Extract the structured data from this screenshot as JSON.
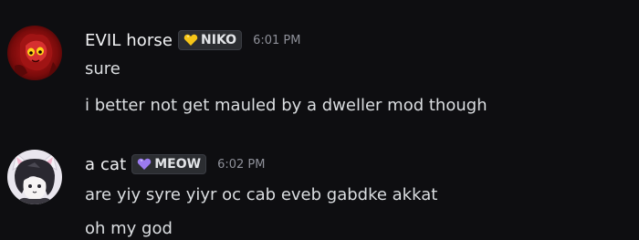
{
  "messages": [
    {
      "username": "EVIL horse",
      "tag": "NIKO",
      "tag_icon": "yellow-heart-icon",
      "tag_icon_color": "#f5c518",
      "timestamp": "6:01 PM",
      "lines": [
        "sure",
        "i better not get mauled by a dweller mod though"
      ]
    },
    {
      "username": "a cat",
      "tag": "MEOW",
      "tag_icon": "purple-heart-icon",
      "tag_icon_color": "#9b7bf0",
      "timestamp": "6:02 PM",
      "lines": [
        "are yiy syre yiyr oc cab eveb gabdke akkat",
        "oh my god"
      ]
    }
  ],
  "colors": {
    "background": "#0e0e11",
    "username": "#f2f3f5",
    "message_text": "#dbdee1",
    "timestamp": "#8e9099"
  }
}
